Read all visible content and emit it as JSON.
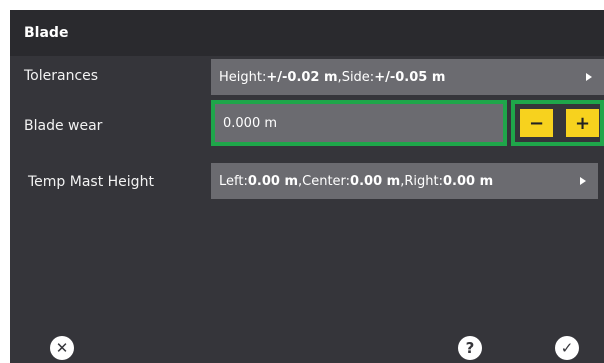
{
  "header": {
    "title": "Blade"
  },
  "rows": {
    "tolerances": {
      "label": "Tolerances",
      "height_label": "Height: ",
      "height_value": "+/-0.02 m",
      "sep": ", ",
      "side_label": "Side: ",
      "side_value": "+/-0.05 m"
    },
    "blade_wear": {
      "label": "Blade wear",
      "value": "0.000 m",
      "minus_label": "−",
      "plus_label": "+"
    },
    "temp_mast_height": {
      "label": "Temp Mast Height",
      "left_label": "Left: ",
      "left_value": "0.00 m",
      "sep1": ", ",
      "center_label": "Center: ",
      "center_value": "0.00 m",
      "sep2": ", ",
      "right_label": "Right: ",
      "right_value": "0.00 m"
    }
  },
  "footer": {
    "cancel_icon_glyph": "✕",
    "help_icon_glyph": "?",
    "confirm_icon_glyph": "✓"
  },
  "colors": {
    "panel_bg": "#35353a",
    "header_bg": "#2a2a2e",
    "field_bg": "#6b6b70",
    "focus_border": "#1fa64a",
    "stepper_button": "#f7d21e"
  }
}
